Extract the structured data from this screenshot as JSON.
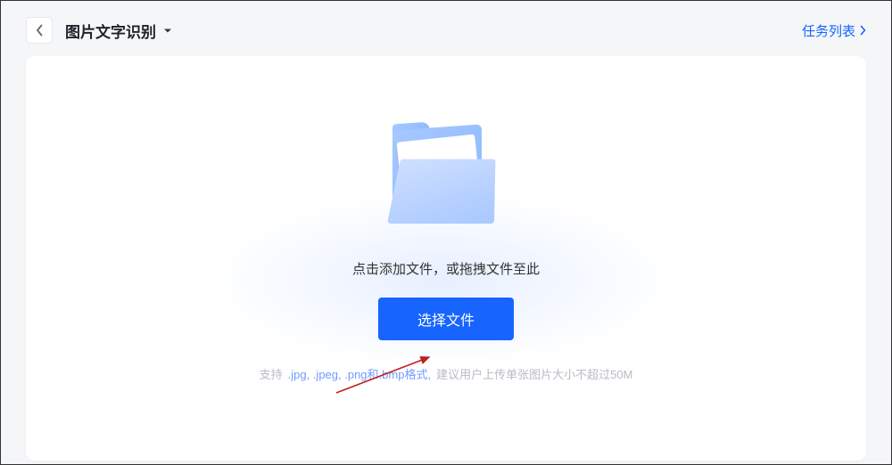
{
  "header": {
    "title": "图片文字识别",
    "task_list_label": "任务列表"
  },
  "upload": {
    "instruction": "点击添加文件，或拖拽文件至此",
    "button_label": "选择文件",
    "hint_prefix": "支持",
    "hint_formats": ".jpg, .jpeg, .png和.bmp格式,",
    "hint_suffix": "建议用户上传单张图片大小不超过50M"
  }
}
